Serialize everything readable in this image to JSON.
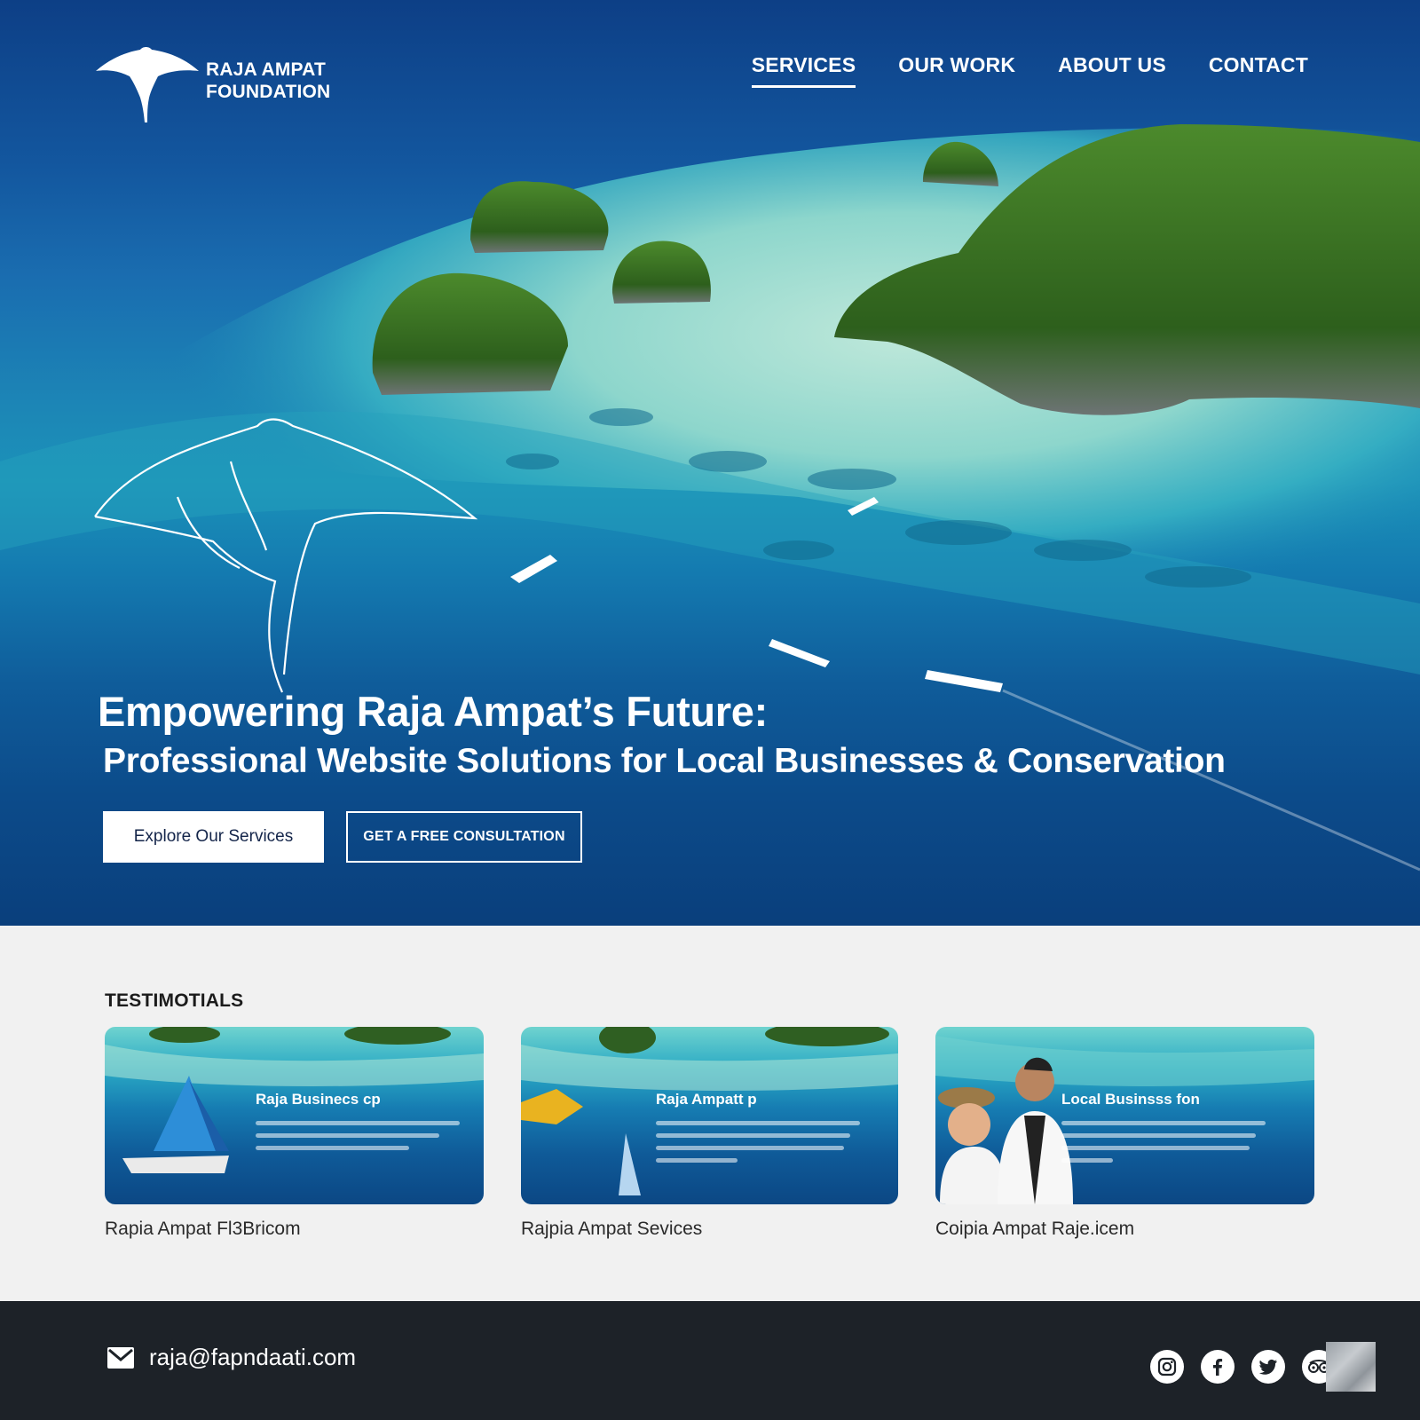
{
  "brand": {
    "line1": "RAJA AMPAT",
    "line2": "FOUNDATION",
    "logo_icon": "manta-ray-icon"
  },
  "nav": {
    "items": [
      {
        "label": "SERVICES",
        "active": true
      },
      {
        "label": "OUR WORK",
        "active": false
      },
      {
        "label": "ABOUT US",
        "active": false
      },
      {
        "label": "CONTACT",
        "active": false
      }
    ]
  },
  "hero": {
    "headline": "Empowering Raja Ampat’s Future:",
    "subheadline": "Professional Website Solutions for Local Businesses & Conservation",
    "primary_button": "Explore Our Services",
    "secondary_button": "GET A FREE CONSULTATION",
    "decor_icon": "manta-ray-outline-icon"
  },
  "testimonials": {
    "title": "TESTIMOTIALS",
    "cards": [
      {
        "title": "Raja Businecs cp",
        "caption": "Rapia Ampat Fl3Bricom"
      },
      {
        "title": "Raja Ampatt p",
        "caption": "Rajpia Ampat Sevices"
      },
      {
        "title": "Local Businsss fon",
        "caption": "Coipia Ampat Raje.icem"
      }
    ]
  },
  "footer": {
    "email": "raja@fapndaati.com",
    "email_icon": "mail-icon",
    "socials": [
      "instagram-icon",
      "facebook-icon",
      "twitter-icon",
      "tripadvisor-icon"
    ]
  },
  "colors": {
    "hero_deep": "#0d3f86",
    "hero_lagoon": "#1b92b9",
    "footer_bg": "#1d2228",
    "section_bg": "#f1f1f1"
  }
}
